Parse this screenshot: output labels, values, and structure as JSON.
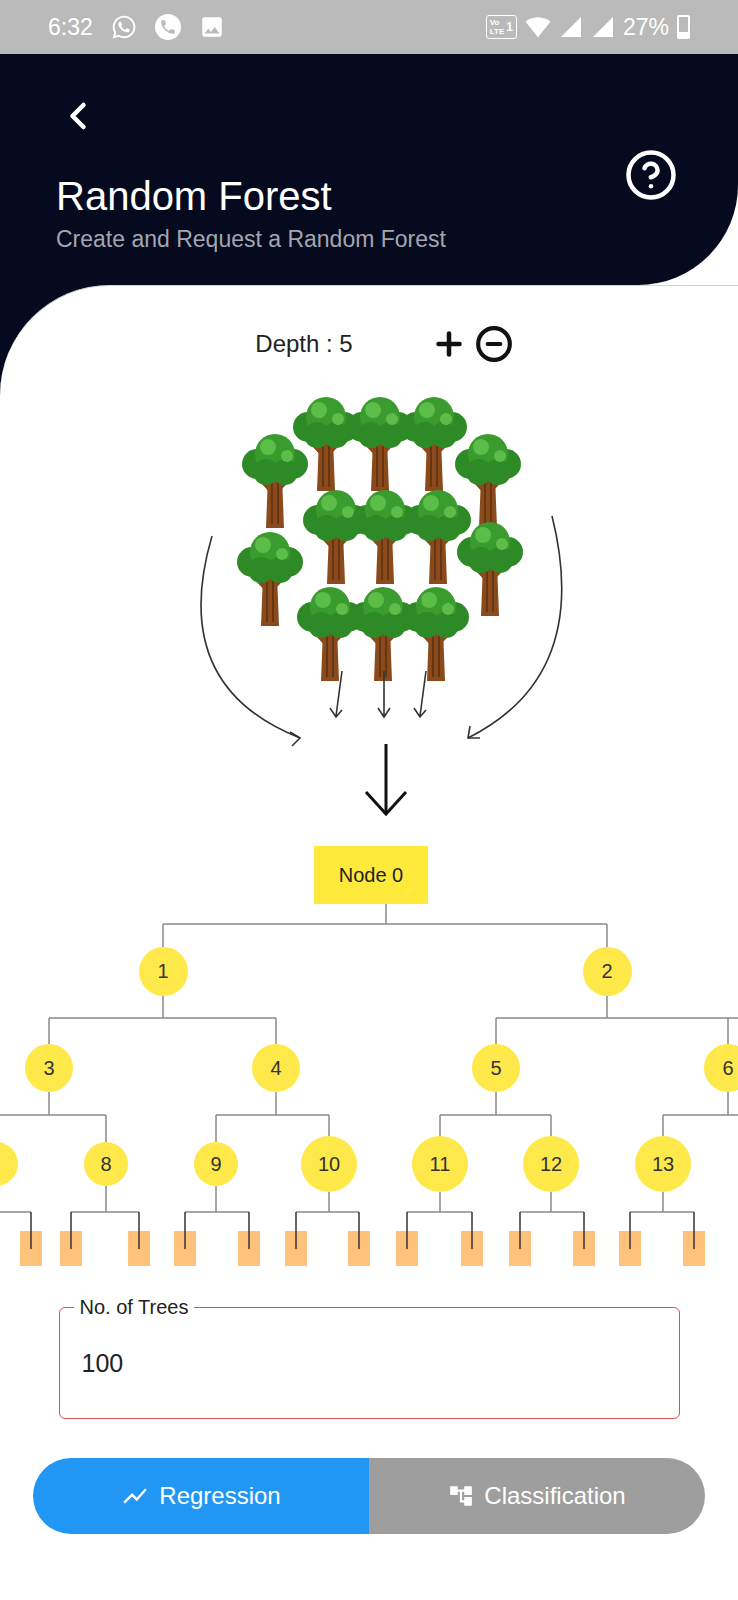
{
  "status_bar": {
    "time": "6:32",
    "volte": {
      "top": "Vo",
      "bottom": "LTE",
      "sim": "1"
    },
    "battery": "27%",
    "battery_level": 0.27
  },
  "header": {
    "title": "Random Forest",
    "subtitle": "Create and Request a Random Forest"
  },
  "depth": {
    "label": "Depth : 5"
  },
  "root_node": "Node 0",
  "nodes": [
    {
      "label": "1"
    },
    {
      "label": "2"
    },
    {
      "label": "3"
    },
    {
      "label": "4"
    },
    {
      "label": "5"
    },
    {
      "label": "6"
    },
    {
      "label": "8"
    },
    {
      "label": "9"
    },
    {
      "label": "10"
    },
    {
      "label": "11"
    },
    {
      "label": "12"
    },
    {
      "label": "13"
    }
  ],
  "trees_field": {
    "label": "No. of Trees",
    "value": "100"
  },
  "modes": [
    {
      "label": "Regression",
      "selected": true
    },
    {
      "label": "Classification",
      "selected": false
    }
  ]
}
